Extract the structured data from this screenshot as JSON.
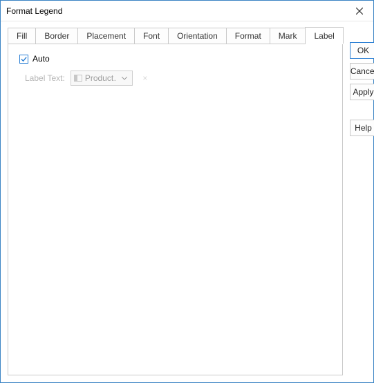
{
  "window": {
    "title": "Format Legend"
  },
  "tabs": {
    "items": [
      {
        "label": "Fill"
      },
      {
        "label": "Border"
      },
      {
        "label": "Placement"
      },
      {
        "label": "Font"
      },
      {
        "label": "Orientation"
      },
      {
        "label": "Format"
      },
      {
        "label": "Mark"
      },
      {
        "label": "Label"
      }
    ],
    "active_index": 7
  },
  "label_tab": {
    "auto_label": "Auto",
    "auto_checked": true,
    "label_text_label": "Label Text:",
    "combo_value": "Product…",
    "clear_symbol": "×"
  },
  "buttons": {
    "ok": "OK",
    "cancel": "Cancel",
    "apply": "Apply",
    "help": "Help"
  }
}
